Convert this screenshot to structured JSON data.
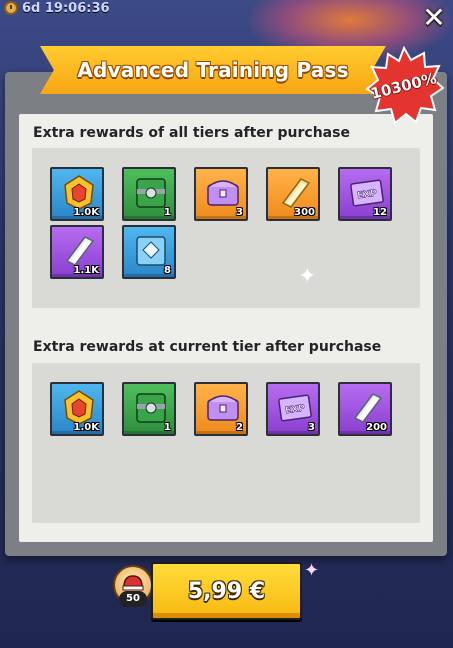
{
  "header": {
    "timer": "6d 19:06:36",
    "close_icon": "close-icon"
  },
  "pass": {
    "title": "Advanced Training Pass",
    "badge_text": "10300%",
    "badge_color": "#e3342f",
    "accent_color": "#f8b811"
  },
  "sections": [
    {
      "title": "Extra rewards of all tiers after purchase",
      "items": [
        {
          "icon": "gold-gem-icon",
          "rarity": "blue",
          "quantity": "1.0K"
        },
        {
          "icon": "green-crate-icon",
          "rarity": "green",
          "quantity": "1"
        },
        {
          "icon": "purple-chest-icon",
          "rarity": "orange",
          "quantity": "3"
        },
        {
          "icon": "gold-bar-icon",
          "rarity": "orange",
          "quantity": "300"
        },
        {
          "icon": "exp-book-icon",
          "rarity": "purple",
          "quantity": "12"
        },
        {
          "icon": "silver-bar-icon",
          "rarity": "purple",
          "quantity": "1.1K"
        },
        {
          "icon": "blue-crate-icon",
          "rarity": "blue",
          "quantity": "8"
        }
      ]
    },
    {
      "title": "Extra rewards at current tier after purchase",
      "items": [
        {
          "icon": "gold-gem-icon",
          "rarity": "blue",
          "quantity": "1.0K"
        },
        {
          "icon": "green-crate-icon",
          "rarity": "green",
          "quantity": "1"
        },
        {
          "icon": "purple-chest-icon",
          "rarity": "orange",
          "quantity": "2"
        },
        {
          "icon": "exp-book-icon",
          "rarity": "purple",
          "quantity": "3"
        },
        {
          "icon": "silver-bar-icon",
          "rarity": "purple",
          "quantity": "200"
        }
      ]
    }
  ],
  "purchase": {
    "price": "5,99 €",
    "bonus_count": "50",
    "bonus_icon": "helmet-token-icon"
  }
}
